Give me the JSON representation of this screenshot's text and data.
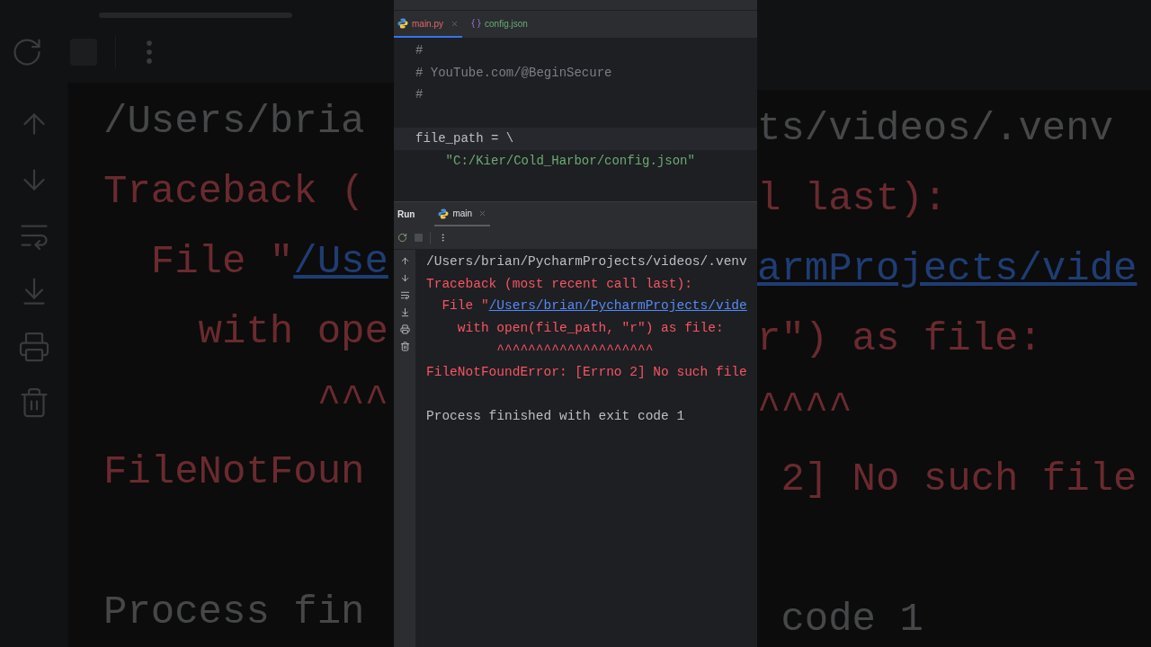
{
  "backdrop": {
    "left_lines": [
      {
        "kind": "output",
        "text": "/Users/bria"
      },
      {
        "kind": "error",
        "text": "Traceback ("
      },
      {
        "kind": "link",
        "prefix": "  File \"",
        "link": "/Use"
      },
      {
        "kind": "error",
        "text": "    with ope"
      },
      {
        "kind": "error",
        "text": "         ^^^"
      },
      {
        "kind": "error",
        "text": "FileNotFoun"
      },
      {
        "kind": "blank"
      },
      {
        "kind": "output",
        "text": "Process fin"
      }
    ],
    "right_lines": [
      {
        "kind": "output",
        "text": "ts/videos/.venv"
      },
      {
        "kind": "error",
        "text": "l last):"
      },
      {
        "kind": "link",
        "link": "armProjects/vide"
      },
      {
        "kind": "error",
        "text": "r\") as file:"
      },
      {
        "kind": "error",
        "text": "^^^^"
      },
      {
        "kind": "error",
        "text": " 2] No such file"
      },
      {
        "kind": "blank"
      },
      {
        "kind": "output",
        "text": " code 1"
      }
    ]
  },
  "editor_tabs": [
    {
      "label": "main.py",
      "kind": "python",
      "selected": true
    },
    {
      "label": "config.json",
      "kind": "json",
      "selected": false
    }
  ],
  "editor_lines": [
    {
      "kind": "comment",
      "text": "#",
      "current": false
    },
    {
      "kind": "comment",
      "text": "# YouTube.com/@BeginSecure",
      "current": false
    },
    {
      "kind": "comment",
      "text": "#",
      "current": false
    },
    {
      "kind": "blank",
      "current": false
    },
    {
      "kind": "code",
      "text": "file_path = \\",
      "current": true
    },
    {
      "kind": "string",
      "text": "    \"C:/Kier/Cold_Harbor/config.json\"",
      "current": false
    }
  ],
  "run_panel": {
    "title": "Run",
    "tabs": [
      {
        "label": "main",
        "selected": true
      }
    ]
  },
  "console_lines": [
    {
      "kind": "output",
      "text": "/Users/brian/PycharmProjects/videos/.venv"
    },
    {
      "kind": "error",
      "text": "Traceback (most recent call last):"
    },
    {
      "kind": "link",
      "prefix": "  File \"",
      "link": "/Users/brian/PycharmProjects/vide"
    },
    {
      "kind": "error",
      "text": "    with open(file_path, \"r\") as file:"
    },
    {
      "kind": "error",
      "text": "         ^^^^^^^^^^^^^^^^^^^^"
    },
    {
      "kind": "error",
      "text": "FileNotFoundError: [Errno 2] No such file"
    },
    {
      "kind": "blank"
    },
    {
      "kind": "output",
      "text": "Process finished with exit code 1"
    }
  ]
}
